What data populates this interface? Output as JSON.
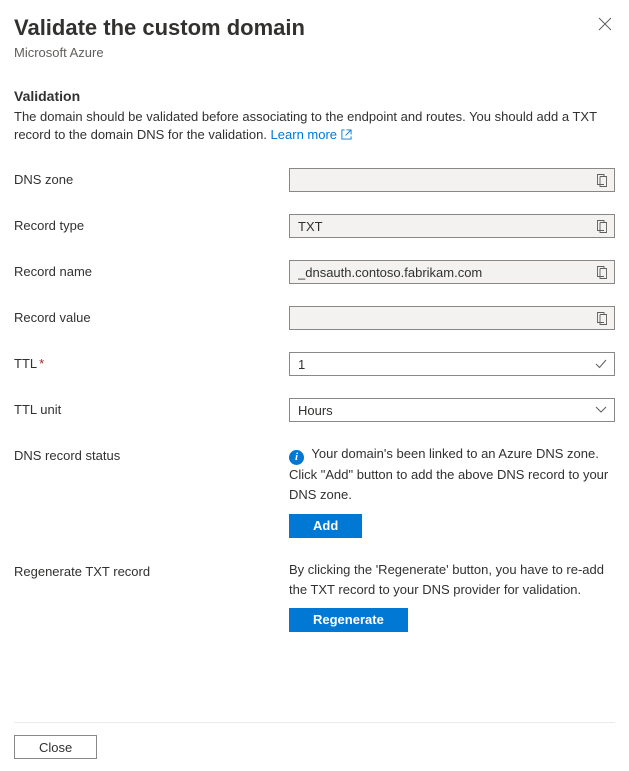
{
  "header": {
    "title": "Validate the custom domain",
    "subtitle": "Microsoft Azure"
  },
  "validation": {
    "heading": "Validation",
    "description": "The domain should be validated before associating to the endpoint and routes. You should add a TXT record to the domain DNS for the validation.",
    "learn_more": "Learn more"
  },
  "fields": {
    "dns_zone": {
      "label": "DNS zone",
      "value": ""
    },
    "record_type": {
      "label": "Record type",
      "value": "TXT"
    },
    "record_name": {
      "label": "Record name",
      "value": "_dnsauth.contoso.fabrikam.com"
    },
    "record_value": {
      "label": "Record value",
      "value": ""
    },
    "ttl": {
      "label": "TTL",
      "value": "1"
    },
    "ttl_unit": {
      "label": "TTL unit",
      "value": "Hours"
    }
  },
  "dns_status": {
    "label": "DNS record status",
    "message": "Your domain's been linked to an Azure DNS zone. Click \"Add\" button to add the above DNS record to your DNS zone.",
    "button": "Add"
  },
  "regenerate": {
    "label": "Regenerate TXT record",
    "message": "By clicking the 'Regenerate' button, you have to re-add the TXT record to your DNS provider for validation.",
    "button": "Regenerate"
  },
  "footer": {
    "close": "Close"
  }
}
